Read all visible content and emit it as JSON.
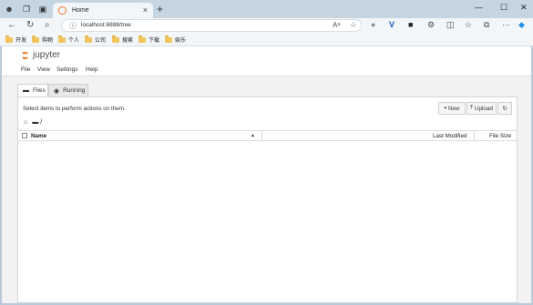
{
  "browser": {
    "tab_title": "Home",
    "tab_close": "×",
    "new_tab": "+",
    "url": "localhost:8888/tree",
    "window_controls": [
      "—",
      "☐",
      "✕"
    ],
    "bookmarks": [
      "开发",
      "购物",
      "个人",
      "公司",
      "搜索",
      "下载",
      "娱乐"
    ]
  },
  "jupyter": {
    "logo_text": "jupyter",
    "menu": [
      "File",
      "View",
      "Settings",
      "Help"
    ],
    "tabs": [
      {
        "label": "Files",
        "icon": "folder-icon"
      },
      {
        "label": "Running",
        "icon": "running-icon"
      }
    ],
    "hint": "Select items to perform actions on them.",
    "toolbar": {
      "new_label": "New",
      "upload_label": "Upload",
      "refresh_icon": "refresh-icon"
    },
    "breadcrumb": "/",
    "columns": {
      "name": "Name",
      "last_modified": "Last Modified",
      "file_size": "File Size"
    }
  },
  "colors": {
    "jupyter_orange": "#f37726",
    "tabstrip": "#c5d5e2",
    "chrome_bg": "#f3f6f9"
  }
}
